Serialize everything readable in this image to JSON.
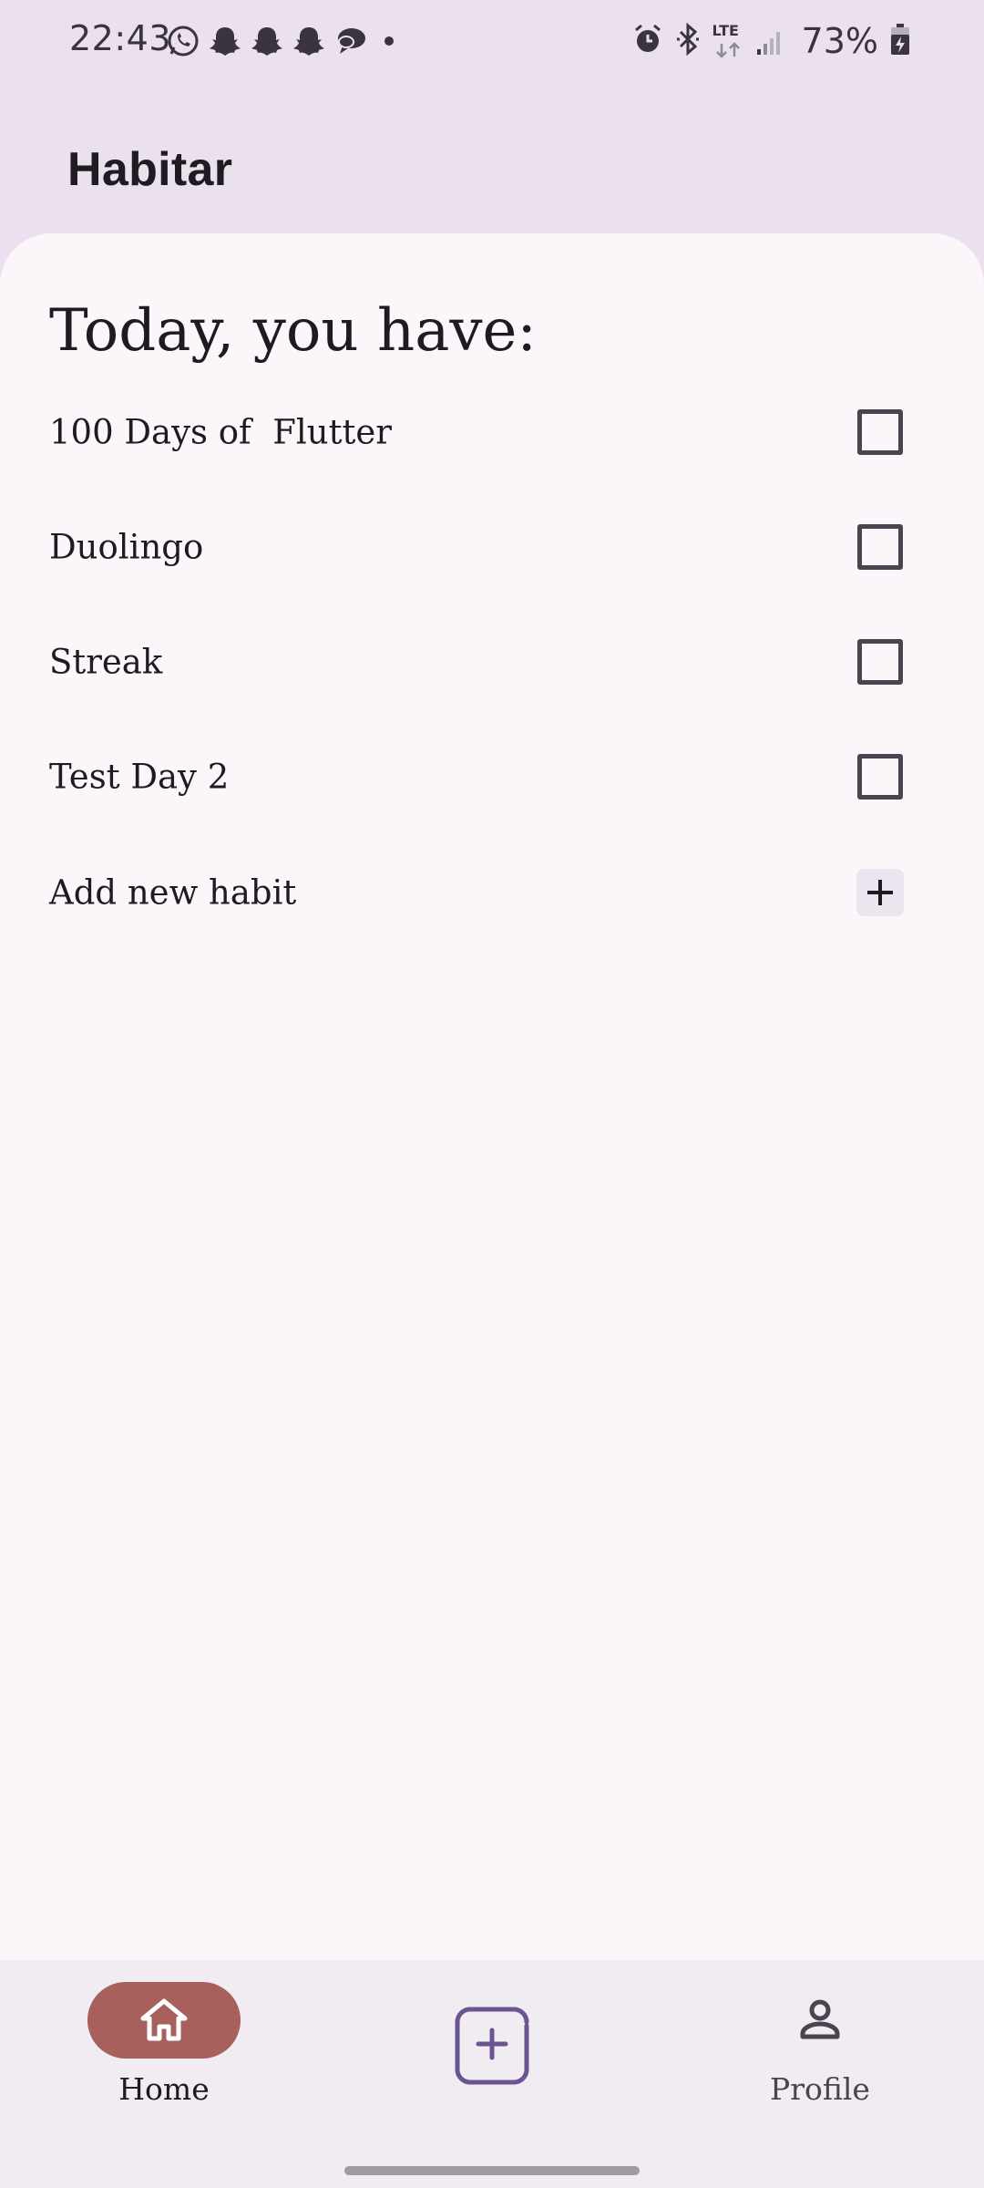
{
  "status_bar": {
    "time": "22:43",
    "notification_icons": [
      "whatsapp-icon",
      "snapchat-icon",
      "snapchat-icon",
      "snapchat-icon",
      "messages-icon",
      "more-dot-icon"
    ],
    "system_icons": [
      "alarm-icon",
      "bluetooth-icon",
      "lte-icon",
      "signal-icon",
      "battery-charging-icon"
    ],
    "network_label": "LTE",
    "battery": "73%"
  },
  "app_bar": {
    "title": "Habitar"
  },
  "main": {
    "heading": "Today, you have:",
    "habits": [
      {
        "label": "100 Days of  Flutter",
        "checked": false
      },
      {
        "label": "Duolingo",
        "checked": false
      },
      {
        "label": "Streak",
        "checked": false
      },
      {
        "label": "Test Day 2",
        "checked": false
      }
    ],
    "add_habit_label": "Add new habit"
  },
  "bottom_nav": {
    "home_label": "Home",
    "profile_label": "Profile",
    "active": "home"
  },
  "colors": {
    "header_bg": "#eae0ee",
    "sheet_bg": "#fcf6fb",
    "nav_bg": "#f1ebf2",
    "active_pill": "#a8605c",
    "accent_purple": "#6b5490"
  }
}
